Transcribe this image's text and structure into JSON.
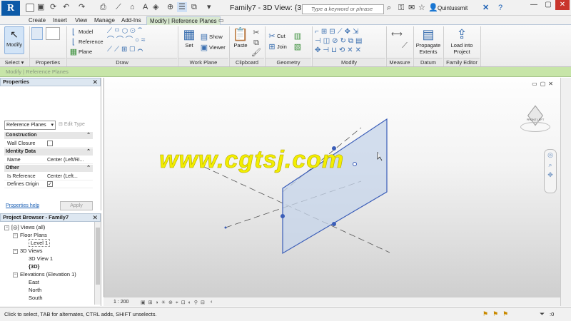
{
  "app": {
    "logo": "R",
    "title": "Family7 - 3D View: {3...",
    "search_placeholder": "Type a keyword or phrase",
    "user": "Quintussmit"
  },
  "tabs": [
    "Create",
    "Insert",
    "View",
    "Manage",
    "Add-Ins",
    "Modify | Reference Planes"
  ],
  "ribbon": {
    "select": {
      "label": "Modify",
      "panel": "Select ▾"
    },
    "properties_panel": "Properties",
    "draw": {
      "model": "Model",
      "reference": "Reference",
      "plane": "Plane",
      "panel": "Draw"
    },
    "workplane": {
      "set": "Set",
      "show": "Show",
      "viewer": "Viewer",
      "panel": "Work Plane"
    },
    "clipboard": {
      "paste": "Paste",
      "panel": "Clipboard"
    },
    "geometry": {
      "cut": "Cut",
      "join": "Join",
      "panel": "Geometry"
    },
    "modify_panel": "Modify",
    "measure_panel": "Measure",
    "datum": {
      "propagate1": "Propagate",
      "propagate2": "Extents",
      "panel": "Datum"
    },
    "family_editor": {
      "load1": "Load into",
      "load2": "Project",
      "panel": "Family Editor"
    }
  },
  "options_bar": "Modify | Reference Planes",
  "properties": {
    "title": "Properties",
    "type_selector": "Reference Planes",
    "edit_type": "Edit Type",
    "sections": [
      {
        "name": "Construction",
        "rows": [
          {
            "k": "Wall Closure",
            "v": ""
          }
        ]
      },
      {
        "name": "Identity Data",
        "rows": [
          {
            "k": "Name",
            "v": "Center (Left/Ri..."
          }
        ]
      },
      {
        "name": "Other",
        "rows": [
          {
            "k": "Is Reference",
            "v": "Center (Left..."
          },
          {
            "k": "Defines Origin",
            "v": "✓"
          }
        ]
      }
    ],
    "help": "Properties help",
    "apply": "Apply"
  },
  "browser": {
    "title": "Project Browser - Family7",
    "items": [
      "Views (all)",
      "Floor Plans",
      "Level 1",
      "3D Views",
      "3D View 1",
      "{3D}",
      "Elevations (Elevation 1)",
      "East",
      "North",
      "South"
    ]
  },
  "view": {
    "scale": "1 : 200",
    "viewcube": "FRONT  LEFT"
  },
  "watermark": "www.cgtsj.com",
  "status": "Click to select, TAB for alternates, CTRL adds, SHIFT unselects.",
  "status_right": ":0",
  "colors": {
    "app_blue": "#0c5aa8",
    "options_bar": "#c7e5a8",
    "ribbon_icon": "#3a6fb0",
    "plane_fill": "#c5d4ea",
    "plane_edge": "#3a5db8"
  }
}
